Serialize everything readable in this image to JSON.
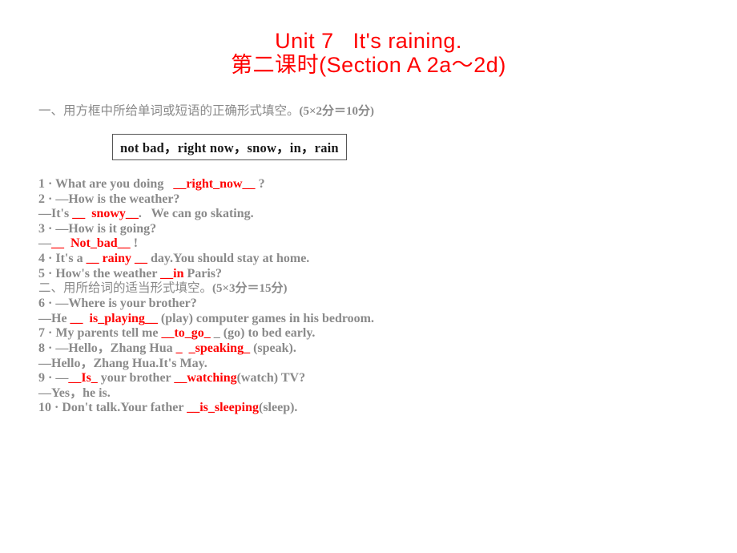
{
  "title": {
    "line1": "Unit 7   It's raining.",
    "line2": "第二课时(Section A 2a～2d)",
    "color": "#ff0000"
  },
  "colors": {
    "body_text": "#8a8a8a",
    "answer_red": "#ff0000",
    "box_border": "#555555",
    "box_text": "#1a1a1a",
    "background": "#ffffff"
  },
  "section_one": {
    "heading_cn": "一、用方框中所给单词或短语的正确形式填空。",
    "heading_score": "(5×2分＝10分)",
    "word_bank": "not bad，right now，snow，in，rain",
    "word_bank_items": [
      "not bad",
      "right now",
      "snow",
      "in",
      "rain"
    ],
    "questions": [
      {
        "number": "1",
        "pre": "1 · What are you doing   ",
        "answer": "__right_now__",
        "post": " ?"
      },
      {
        "number": "2",
        "pre": "2 · —How is the weather?",
        "answer": "",
        "post": ""
      },
      {
        "number": "2b",
        "pre": "—It's ",
        "answer": "__  snowy__",
        "post": ".   We can go skating."
      },
      {
        "number": "3",
        "pre": "3 · —How is it going?",
        "answer": "",
        "post": ""
      },
      {
        "number": "3b",
        "pre": "—",
        "answer": "__  Not_bad__",
        "post": " !"
      },
      {
        "number": "4",
        "pre": "4 · It's a ",
        "answer": "__ rainy __",
        "post": " day.You should stay at home."
      },
      {
        "number": "5",
        "pre": "5 · How's the weather ",
        "answer": "__in",
        "post": " Paris?"
      }
    ]
  },
  "section_two": {
    "heading_cn": "二、用所给词的适当形式填空。",
    "heading_score": "(5×3分＝15分)",
    "questions": [
      {
        "number": "6",
        "pre": "6 · —Where is your brother?",
        "answer": "",
        "post": ""
      },
      {
        "number": "6b",
        "pre": "—He ",
        "answer": "__  is_playing__",
        "post": " (play) computer games in his bedroom."
      },
      {
        "number": "7",
        "pre": "7 · My parents tell me ",
        "answer": "__to_go_",
        "post": " _ (go) to bed early."
      },
      {
        "number": "8",
        "pre": "8 · —Hello，Zhang Hua ",
        "answer": "_  _speaking_",
        "post": " (speak)."
      },
      {
        "number": "8b",
        "pre": "—Hello，Zhang Hua.It's May.",
        "answer": "",
        "post": ""
      },
      {
        "number": "9",
        "pre": "9 · —",
        "answer": "__Is_",
        "post": " your brother ",
        "answer2": "__watching",
        "post2": "(watch) TV?"
      },
      {
        "number": "9b",
        "pre": "—Yes，he is.",
        "answer": "",
        "post": ""
      },
      {
        "number": "10",
        "pre": "10 · Don't talk.Your father ",
        "answer": "__is_sleeping",
        "post": "(sleep)."
      }
    ]
  }
}
